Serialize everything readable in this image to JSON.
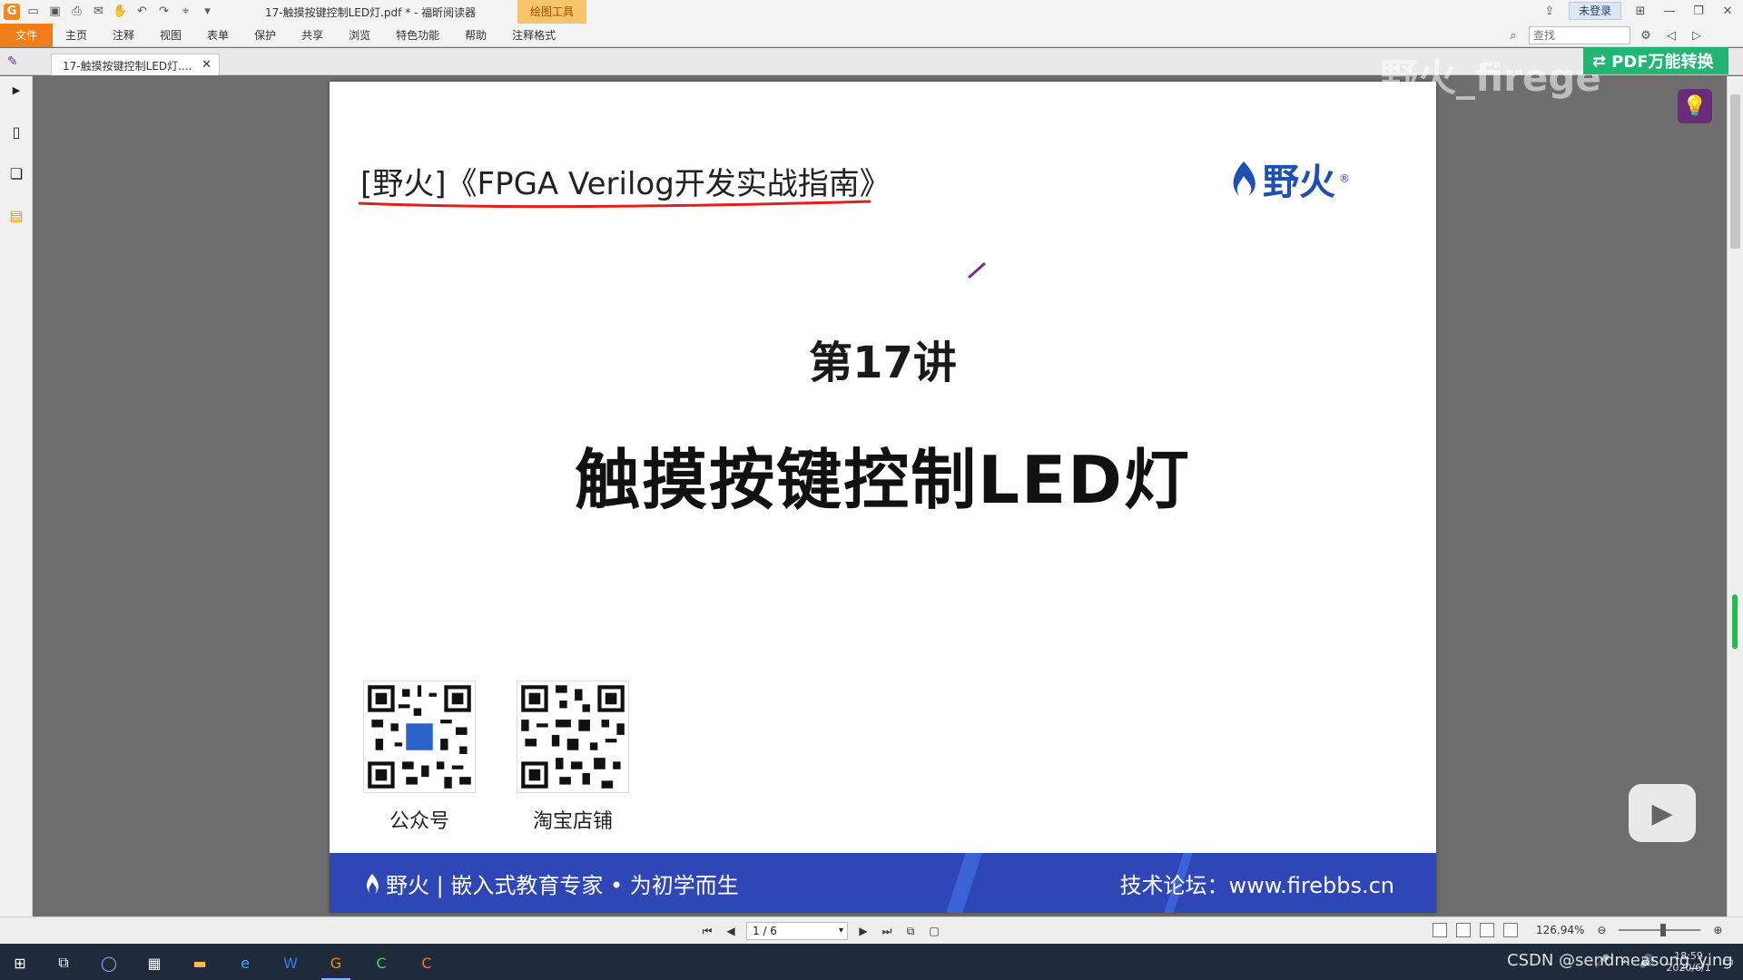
{
  "window": {
    "title": "17-触摸按键控制LED灯.pdf * - 福昕阅读器",
    "context_tab": "绘图工具",
    "login_label": "未登录"
  },
  "menu": [
    "文件",
    "主页",
    "注释",
    "视图",
    "表单",
    "保护",
    "共享",
    "浏览",
    "特色功能",
    "帮助",
    "注释格式"
  ],
  "search": {
    "placeholder": "查找"
  },
  "tab": {
    "label": "17-触摸按键控制LED灯...."
  },
  "page": {
    "course_title": "[野火]《FPGA  Verilog开发实战指南》",
    "brand": "野火",
    "lecture_no": "第17讲",
    "lecture_title": "触摸按键控制LED灯",
    "qr_codes": [
      {
        "label": "公众号"
      },
      {
        "label": "淘宝店铺"
      }
    ],
    "footer_left": "野火 | 嵌入式教育专家 • 为初学而生",
    "footer_right": "技术论坛：www.firebbs.cn"
  },
  "overlays": {
    "pdf_convert": "PDF万能转换",
    "watermark": "野火_firege"
  },
  "statusbar": {
    "page_indicator": "1 / 6",
    "zoom": "126.94%"
  },
  "taskbar": {
    "time": "18:59",
    "date": "2020/6/1",
    "csdn": "CSDN @sendmeasong_ying"
  },
  "colors": {
    "accent_orange": "#ef7d1a",
    "brand_blue": "#1f4fb4",
    "footer_blue": "#2f47b6",
    "annotation_red": "#e02020"
  }
}
